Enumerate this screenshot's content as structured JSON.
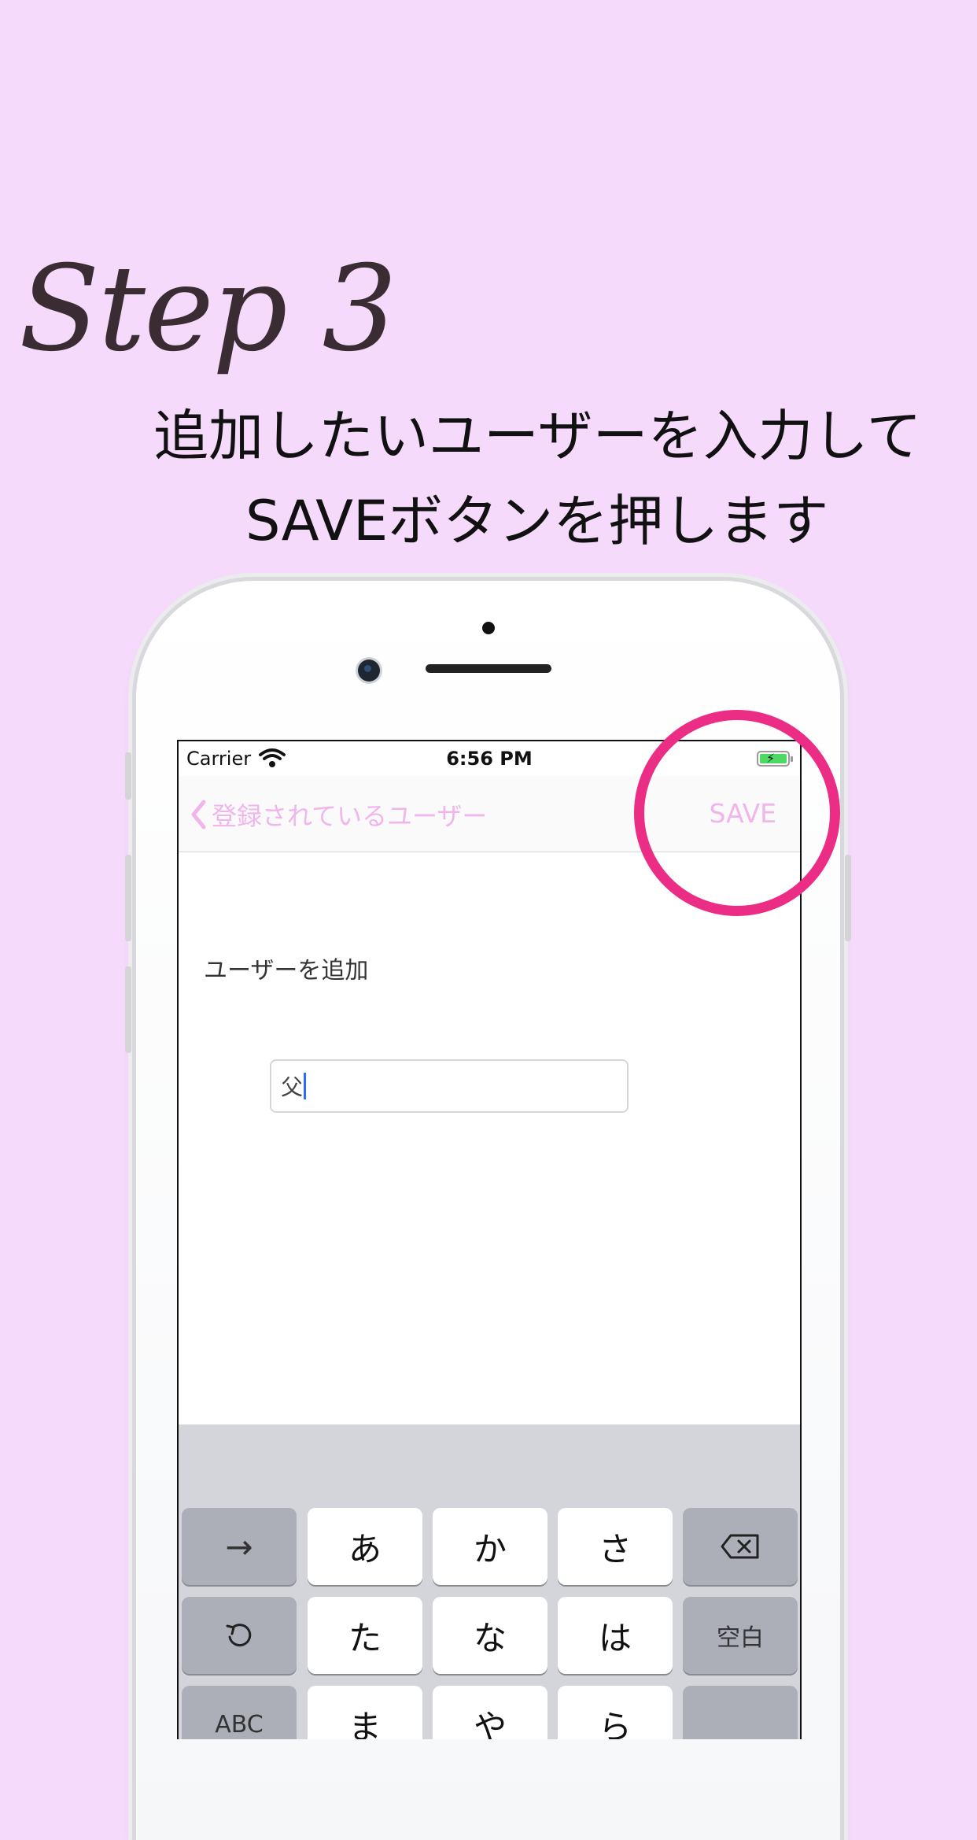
{
  "step_title": "Step 3",
  "headline": {
    "line1": "追加したいユーザーを入力して",
    "line2": "SAVEボタンを押します"
  },
  "status_bar": {
    "carrier": "Carrier",
    "time": "6:56 PM"
  },
  "navbar": {
    "back_label": "登録されているユーザー",
    "save_label": "SAVE"
  },
  "form": {
    "section_label": "ユーザーを追加",
    "input_value": "父"
  },
  "keyboard": {
    "row1": [
      "→",
      "あ",
      "か",
      "さ",
      "⌫"
    ],
    "row2": [
      "↺",
      "た",
      "な",
      "は",
      "空白"
    ],
    "row3": [
      "ABC",
      "ま",
      "や",
      "ら",
      ""
    ]
  },
  "colors": {
    "background": "#f5dafb",
    "accent_pink": "#f0b6ec",
    "highlight_circle": "#ec2d85"
  }
}
